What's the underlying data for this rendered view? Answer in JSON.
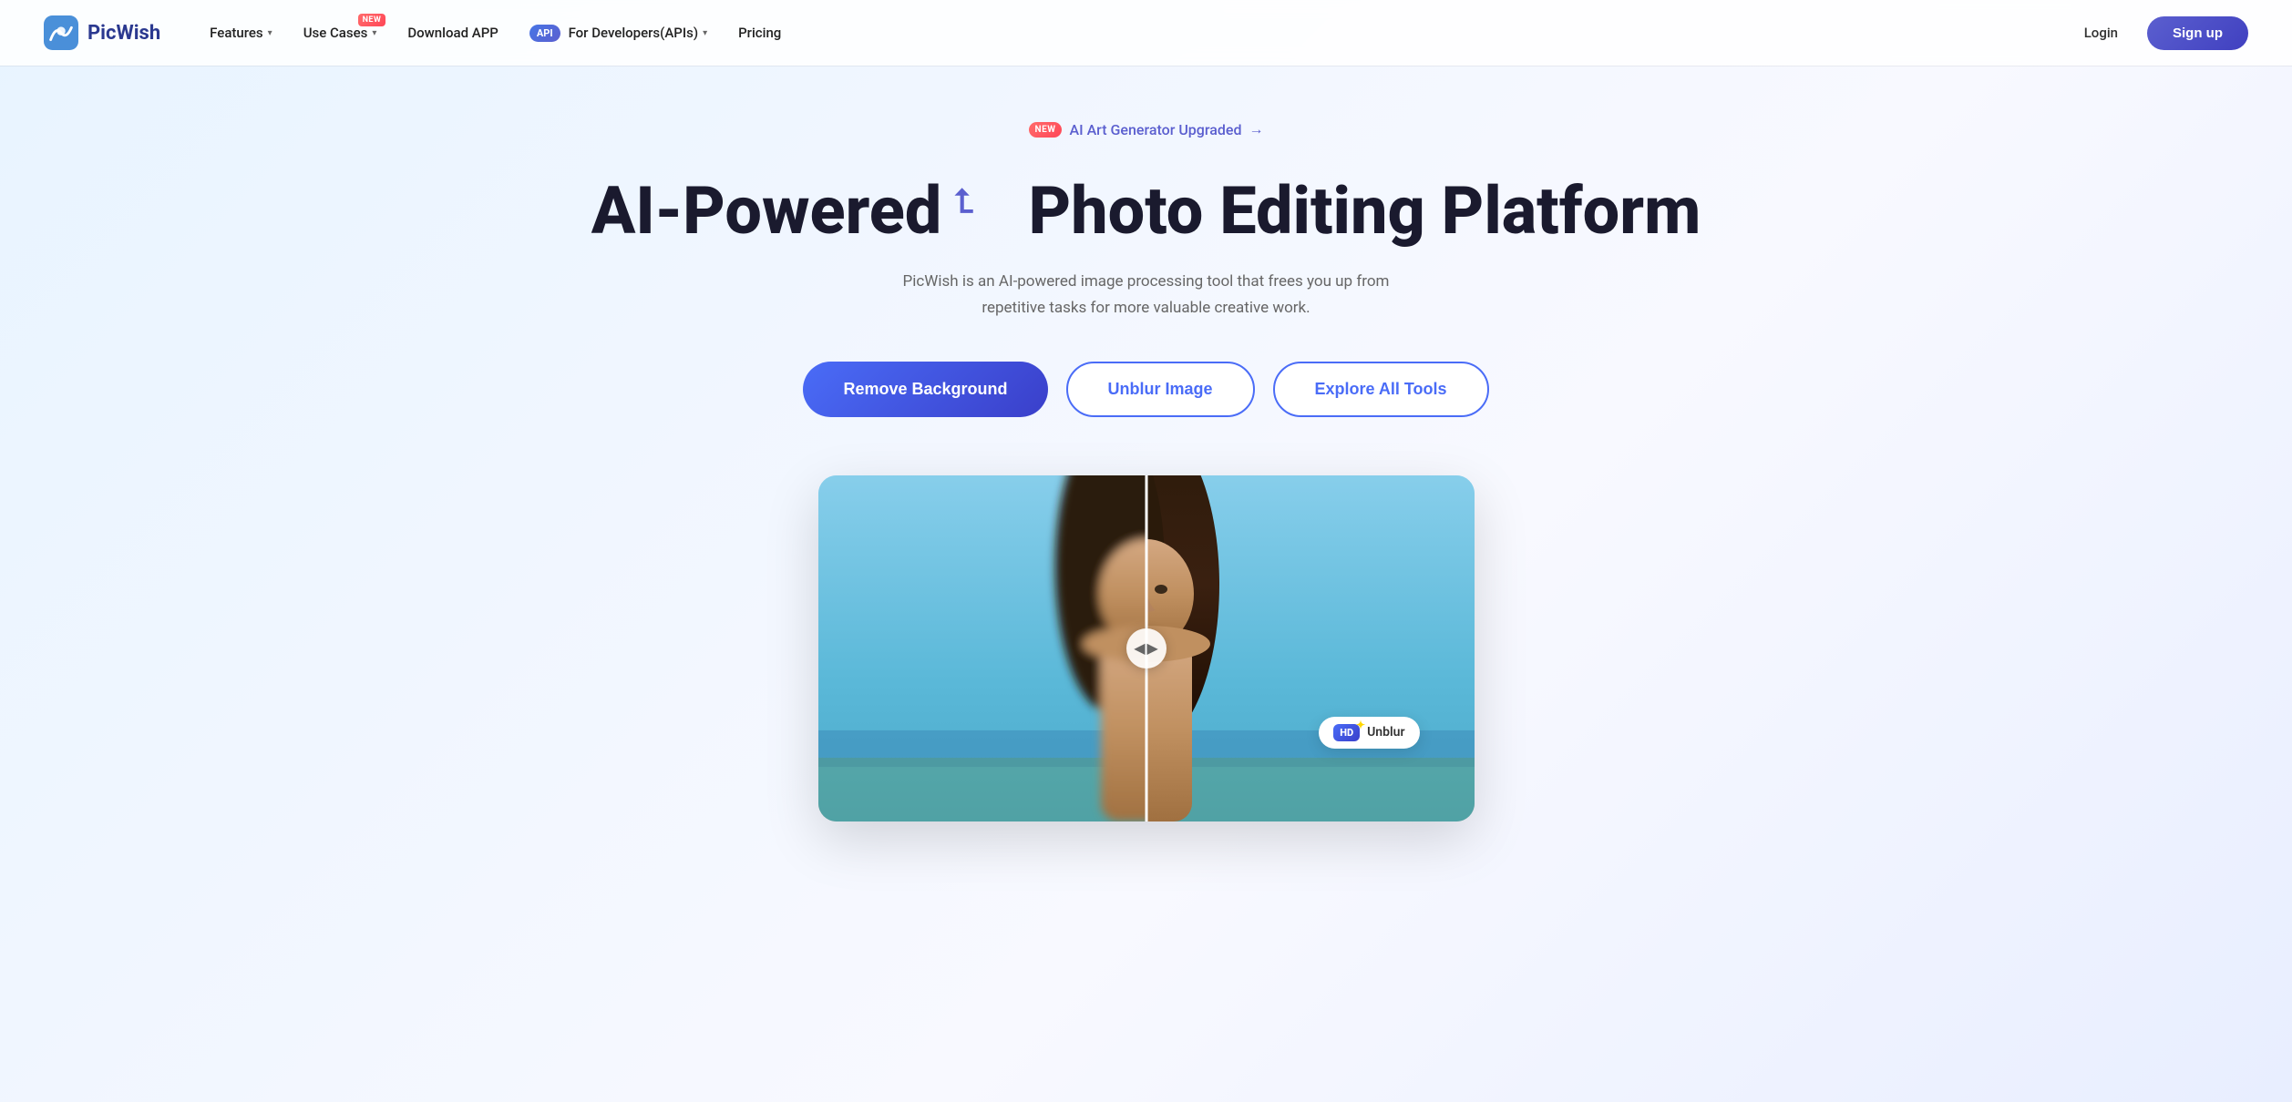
{
  "brand": {
    "name": "PicWish",
    "logo_text": "PicWish"
  },
  "nav": {
    "items": [
      {
        "label": "Features",
        "has_dropdown": true,
        "has_new": false
      },
      {
        "label": "Use Cases",
        "has_dropdown": true,
        "has_new": true
      },
      {
        "label": "Download APP",
        "has_dropdown": false,
        "has_new": false
      },
      {
        "label": "For Developers(APIs)",
        "has_dropdown": true,
        "has_new": false,
        "has_api": true
      },
      {
        "label": "Pricing",
        "has_dropdown": false,
        "has_new": false
      }
    ],
    "login_label": "Login",
    "signup_label": "Sign up"
  },
  "announcement": {
    "badge": "NEW",
    "text": "AI Art Generator Upgraded",
    "arrow": "→"
  },
  "hero": {
    "title_left": "AI-Powered",
    "title_right": "Photo Editing Platform",
    "subtitle": "PicWish is an AI-powered image processing tool that frees you up from repetitive tasks for more valuable creative work.",
    "btn_primary": "Remove Background",
    "btn_secondary1": "Unblur Image",
    "btn_secondary2": "Explore All Tools"
  },
  "demo": {
    "slider_left": "◀",
    "slider_right": "▶",
    "hd_label": "HD",
    "hd_star": "✦",
    "unblur_text": "Unblur"
  },
  "colors": {
    "primary": "#4a6cf7",
    "primary_dark": "#3a3fca",
    "accent_red": "#ff4757",
    "text_dark": "#1a1a2e",
    "text_gray": "#666666"
  }
}
